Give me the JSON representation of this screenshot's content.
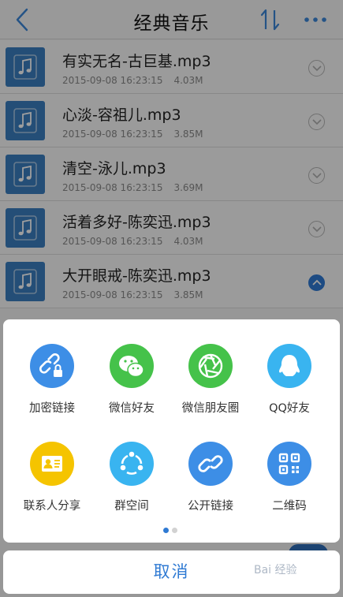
{
  "header": {
    "title": "经典音乐"
  },
  "files": [
    {
      "name": "有实无名-古巨基.mp3",
      "date": "2015-09-08 16:23:15",
      "size": "4.03M",
      "expanded": false
    },
    {
      "name": "心淡-容祖儿.mp3",
      "date": "2015-09-08 16:23:15",
      "size": "3.85M",
      "expanded": false
    },
    {
      "name": "清空-泳儿.mp3",
      "date": "2015-09-08 16:23:15",
      "size": "3.69M",
      "expanded": false
    },
    {
      "name": "活着多好-陈奕迅.mp3",
      "date": "2015-09-08 16:23:15",
      "size": "4.03M",
      "expanded": false
    },
    {
      "name": "大开眼戒-陈奕迅.mp3",
      "date": "2015-09-08 16:23:15",
      "size": "3.85M",
      "expanded": true
    }
  ],
  "share": {
    "items": [
      {
        "label": "加密链接",
        "icon": "encrypted-link-icon",
        "color": "#3d8ee6"
      },
      {
        "label": "微信好友",
        "icon": "wechat-icon",
        "color": "#45c24a"
      },
      {
        "label": "微信朋友圈",
        "icon": "wechat-moments-icon",
        "color": "#45c24a"
      },
      {
        "label": "QQ好友",
        "icon": "qq-icon",
        "color": "#39b4f0"
      },
      {
        "label": "联系人分享",
        "icon": "contact-card-icon",
        "color": "#f5c400"
      },
      {
        "label": "群空间",
        "icon": "group-space-icon",
        "color": "#39b4f0"
      },
      {
        "label": "公开链接",
        "icon": "public-link-icon",
        "color": "#3d8ee6"
      },
      {
        "label": "二维码",
        "icon": "qr-code-icon",
        "color": "#3d8ee6"
      }
    ],
    "page": {
      "current": 1,
      "total": 2
    }
  },
  "cancel_label": "取消",
  "watermark": "Bai  经验",
  "colors": {
    "accent": "#2f7ad3",
    "file_icon": "#3a7fc1"
  }
}
